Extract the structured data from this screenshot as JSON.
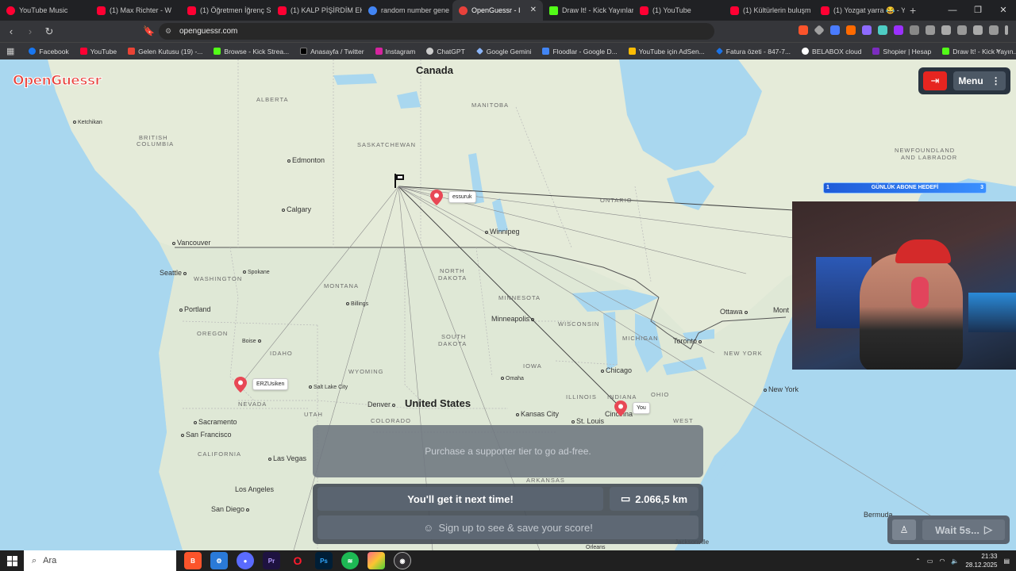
{
  "browser": {
    "tabs": [
      {
        "title": "YouTube Music",
        "color": "#ff0033"
      },
      {
        "title": "(1) Max Richter - W",
        "color": "#ff0033"
      },
      {
        "title": "(1) Öğretmen İğrenç S",
        "color": "#ff0033"
      },
      {
        "title": "(1) KALP PİŞİRDİM EKİP",
        "color": "#ff0033"
      },
      {
        "title": "random number gene",
        "color": "#4285f4"
      },
      {
        "title": "OpenGuessr - I",
        "color": "#e8413b",
        "active": true
      },
      {
        "title": "Draw It! - Kick Yayınlar",
        "color": "#53fc18"
      },
      {
        "title": "(1) YouTube",
        "color": "#ff0033"
      },
      {
        "title": "(1) Kültürlerin buluşm",
        "color": "#ff0033"
      },
      {
        "title": "(1) Yozgat yarra 😂 - Y",
        "color": "#ff0033"
      }
    ],
    "url": "openguessr.com",
    "bookmarks": [
      {
        "label": "Facebook",
        "color": "#1877f2"
      },
      {
        "label": "YouTube",
        "color": "#ff0033"
      },
      {
        "label": "Gelen Kutusu (19) -...",
        "color": "#ea4335"
      },
      {
        "label": "Browse - Kick Strea...",
        "color": "#53fc18"
      },
      {
        "label": "Anasayfa / Twitter",
        "color": "#000000"
      },
      {
        "label": "Instagram",
        "color": "#d6249f"
      },
      {
        "label": "ChatGPT",
        "color": "#cccccc"
      },
      {
        "label": "Google Gemini",
        "color": "#8ab4f8"
      },
      {
        "label": "Floodlar - Google D...",
        "color": "#4285f4"
      },
      {
        "label": "YouTube için AdSen...",
        "color": "#fbbc04"
      },
      {
        "label": "Fatura özeti - 847-7...",
        "color": "#1a73e8"
      },
      {
        "label": "BELABOX cloud",
        "color": "#ffffff"
      },
      {
        "label": "Shopier | Hesap",
        "color": "#7b2cbf"
      },
      {
        "label": "Draw It! - Kick Yayın...",
        "color": "#53fc18"
      }
    ]
  },
  "app": {
    "logo": "OpenGuessr",
    "menu_label": "Menu",
    "ad_text": "Purchase a supporter tier to go ad-free.",
    "result_message": "You'll get it next time!",
    "distance": "2.066,5 km",
    "signup_text": "Sign up to see & save your score!",
    "wait_text": "Wait 5s...",
    "sub_goal": {
      "label": "GÜNLÜK ABONE HEDEFİ",
      "left": "1",
      "right": "3"
    }
  },
  "map": {
    "countries": {
      "canada": "Canada",
      "usa": "United States"
    },
    "states": {
      "alberta": "ALBERTA",
      "bc1": "BRITISH",
      "bc2": "COLUMBIA",
      "sask": "SASKATCHEWAN",
      "manitoba": "MANITOBA",
      "ontario": "ONTARIO",
      "nf1": "NEWFOUNDLAND",
      "nf2": "AND LABRADOR",
      "washington": "WASHINGTON",
      "montana": "MONTANA",
      "nd1": "NORTH",
      "nd2": "DAKOTA",
      "sd1": "SOUTH",
      "sd2": "DAKOTA",
      "minnesota": "MINNESOTA",
      "wisconsin": "WISCONSIN",
      "michigan": "MICHIGAN",
      "oregon": "OREGON",
      "idaho": "IDAHO",
      "wyoming": "WYOMING",
      "nevada": "NEVADA",
      "utah": "UTAH",
      "colorado": "COLORADO",
      "california": "CALIFORNIA",
      "newyork": "NEW YORK",
      "illinois": "ILLINOIS",
      "indiana": "INDIANA",
      "ohio": "OHIO",
      "arkansas": "ARKANSAS",
      "west": "WEST",
      "iowa": "IOWA"
    },
    "cities": {
      "ketchikan": "Ketchikan",
      "edmonton": "Edmonton",
      "calgary": "Calgary",
      "vancouver": "Vancouver",
      "seattle": "Seattle",
      "spokane": "Spokane",
      "portland": "Portland",
      "boise": "Boise",
      "billings": "Billings",
      "winnipeg": "Winnipeg",
      "minneapolis": "Minneapolis",
      "ottawa": "Ottawa",
      "montreal": "Mont",
      "toronto": "Toronto",
      "chicago": "Chicago",
      "newyork": "New York",
      "omaha": "Omaha",
      "saltlake": "Salt Lake City",
      "denver": "Denver",
      "kansascity": "Kansas City",
      "stlouis": "St. Louis",
      "cincinnati": "Cincinna",
      "sacramento": "Sacramento",
      "sanfrancisco": "San Francisco",
      "lasvegas": "Las Vegas",
      "losangeles": "Los Angeles",
      "sandiego": "San Diego",
      "bermuda": "Bermuda",
      "jacksonville": "Jacksonville",
      "orleans": "Orleans"
    },
    "pins": [
      {
        "label": "essuruk"
      },
      {
        "label": "ERZUsiken"
      },
      {
        "label": "You"
      }
    ]
  },
  "taskbar": {
    "search_placeholder": "Ara",
    "time": "21:33",
    "date": "28.12.2025"
  }
}
